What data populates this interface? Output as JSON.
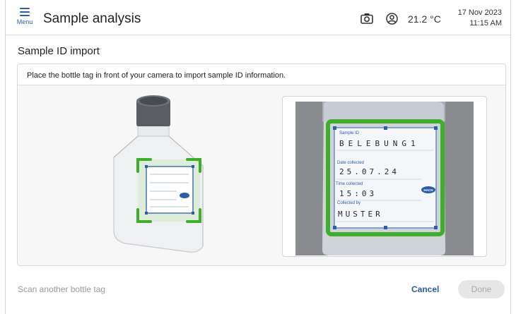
{
  "header": {
    "menu_label": "Menu",
    "title": "Sample analysis",
    "temperature": "21.2 °C",
    "date": "17 Nov 2023",
    "time": "11:15 AM",
    "icons": [
      "camera-icon",
      "user-icon"
    ]
  },
  "section_title": "Sample ID import",
  "instruction": "Place the bottle tag in front of your camera to import sample ID information.",
  "tag": {
    "sample_id_label": "Sample ID",
    "sample_id_value": "BELEBUNG1",
    "date_label": "Date collected",
    "date_value": "25.07.24",
    "time_label": "Time collected",
    "time_value": "15:03",
    "collected_by_label": "Collected by",
    "collected_by_value": "MUSTER",
    "brand": "HACH"
  },
  "footer": {
    "scan_another": "Scan another bottle tag",
    "cancel": "Cancel",
    "done": "Done"
  },
  "colors": {
    "accent": "#2d5da8",
    "frame_green": "#3fae2a",
    "disabled_bg": "#e6e6e6",
    "disabled_text": "#a8a8a8"
  }
}
